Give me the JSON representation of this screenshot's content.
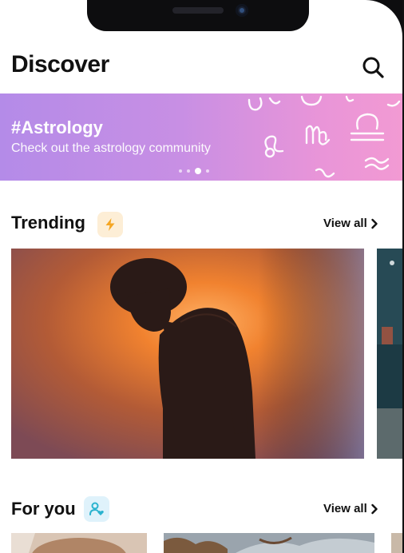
{
  "header": {
    "title": "Discover",
    "search_icon": "search-icon"
  },
  "banner": {
    "tag": "#Astrology",
    "subtitle": "Check out the astrology community",
    "pager": {
      "count": 4,
      "active_index": 2
    }
  },
  "trending": {
    "title": "Trending",
    "badge_icon": "lightning-icon",
    "badge_color": "#f5a623",
    "view_all_label": "View all"
  },
  "for_you": {
    "title": "For you",
    "badge_icon": "person-heart-icon",
    "badge_color": "#2bb3cf",
    "view_all_label": "View all"
  },
  "colors": {
    "banner_start": "#b48be8",
    "banner_end": "#f29ad3",
    "text": "#111111"
  }
}
